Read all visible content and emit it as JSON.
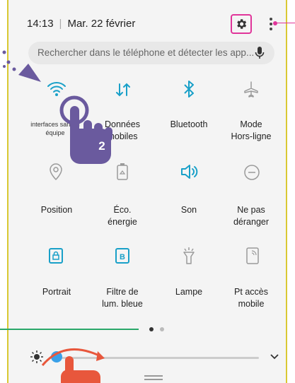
{
  "status": {
    "time": "14:13",
    "date": "Mar. 22 février"
  },
  "search": {
    "placeholder": "Rechercher dans le téléphone et détecter les app..."
  },
  "tiles": [
    {
      "label": "interfaces sans fil équipe",
      "icon": "wifi-icon",
      "active": true
    },
    {
      "label": "Données mobiles",
      "icon": "data-transfer-icon",
      "active": true
    },
    {
      "label": "Bluetooth",
      "icon": "bluetooth-icon",
      "active": true
    },
    {
      "label": "Mode Hors-ligne",
      "icon": "airplane-icon",
      "active": false
    },
    {
      "label": "Position",
      "icon": "location-icon",
      "active": false
    },
    {
      "label": "Éco. énergie",
      "icon": "battery-saver-icon",
      "active": false
    },
    {
      "label": "Son",
      "icon": "sound-icon",
      "active": true
    },
    {
      "label": "Ne pas déranger",
      "icon": "do-not-disturb-icon",
      "active": false
    },
    {
      "label": "Portrait",
      "icon": "portrait-lock-icon",
      "active": true
    },
    {
      "label": "Filtre de lum. bleue",
      "icon": "blue-light-filter-icon",
      "active": true
    },
    {
      "label": "Lampe",
      "icon": "flashlight-icon",
      "active": false
    },
    {
      "label": "Pt accès mobile",
      "icon": "hotspot-icon",
      "active": false
    }
  ],
  "annotation": {
    "step_number": "2"
  },
  "colors": {
    "active": "#19a0c8",
    "inactive": "#9a9a9a",
    "highlight": "#e0359a",
    "pointer": "#6a5a9e",
    "frame": "#d9c833"
  },
  "brightness": {
    "level": 0.02
  }
}
